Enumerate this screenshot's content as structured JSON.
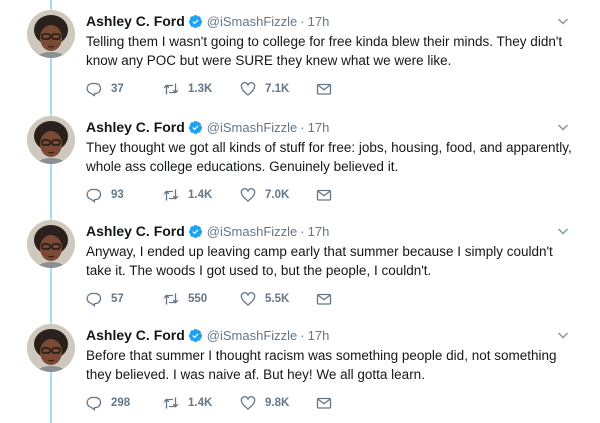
{
  "tweets": [
    {
      "name": "Ashley C. Ford",
      "handle": "@iSmashFizzle",
      "separator": "·",
      "time": "17h",
      "lines": [
        "Telling them I wasn't going to college for free kinda blew their minds. They didn't",
        "know any POC but were SURE they knew what we were like."
      ],
      "replies": "37",
      "retweets": "1.3K",
      "likes": "7.1K"
    },
    {
      "name": "Ashley C. Ford",
      "handle": "@iSmashFizzle",
      "separator": "·",
      "time": "17h",
      "lines": [
        "They thought we got all kinds of stuff for free: jobs, housing, food, and apparently,",
        "whole ass college educations. Genuinely believed it."
      ],
      "replies": "93",
      "retweets": "1.4K",
      "likes": "7.0K"
    },
    {
      "name": "Ashley C. Ford",
      "handle": "@iSmashFizzle",
      "separator": "·",
      "time": "17h",
      "lines": [
        "Anyway, I ended up leaving camp early that summer because I simply couldn't",
        "take it. The woods I got used to, but the people, I couldn't."
      ],
      "replies": "57",
      "retweets": "550",
      "likes": "5.5K"
    },
    {
      "name": "Ashley C. Ford",
      "handle": "@iSmashFizzle",
      "separator": "·",
      "time": "17h",
      "lines": [
        "Before that summer I thought racism was something people did, not something",
        "they believed. I was naive af. But hey! We all gotta learn."
      ],
      "replies": "298",
      "retweets": "1.4K",
      "likes": "9.8K"
    }
  ],
  "icons": {
    "reply": "reply-icon",
    "retweet": "retweet-icon",
    "like": "heart-icon",
    "message": "envelope-icon",
    "verified": "verified-badge-icon",
    "caret": "chevron-down-icon"
  },
  "colors": {
    "thread_line": "#a9dbf7",
    "verified": "#1da1f2",
    "meta": "#657786",
    "text": "#14171a"
  }
}
